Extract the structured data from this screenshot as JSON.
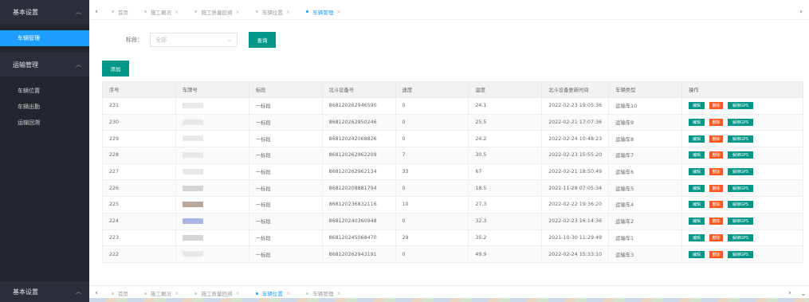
{
  "sidebar": {
    "group1": "基本设置",
    "group1_items": [
      {
        "label": "车辆管理",
        "active": true
      }
    ],
    "group2": "运输管理",
    "group2_items": [
      {
        "label": "车辆位置"
      },
      {
        "label": "车辆出勤"
      },
      {
        "label": "运输回溯"
      }
    ],
    "bottom_group": "基本设置"
  },
  "top_tabs": [
    {
      "label": "首页",
      "active": false
    },
    {
      "label": "施工概况",
      "active": false
    },
    {
      "label": "施工质量回溯",
      "active": false
    },
    {
      "label": "车辆位置",
      "active": false
    },
    {
      "label": "车辆管理",
      "active": true
    }
  ],
  "bottom_tabs": [
    {
      "label": "首页",
      "active": false
    },
    {
      "label": "施工概况",
      "active": false
    },
    {
      "label": "施工质量回溯",
      "active": false
    },
    {
      "label": "车辆位置",
      "active": true
    },
    {
      "label": "车辆管理",
      "active": false
    }
  ],
  "filter": {
    "label": "标段：",
    "placeholder": "全部",
    "query_button": "查询"
  },
  "add_button": "添加",
  "table": {
    "headers": [
      "序号",
      "车牌号",
      "标段",
      "北斗设备号",
      "速度",
      "温度",
      "北斗设备更新时间",
      "车辆类型",
      "操作"
    ],
    "rows": [
      {
        "id": "231",
        "plate": "",
        "section": "一标段",
        "device": "868120262946590",
        "speed": "0",
        "temp": "24.1",
        "time": "2022-02-23 19:05:36",
        "type": "运输车10"
      },
      {
        "id": "230",
        "plate": "",
        "section": "一标段",
        "device": "868120262950246",
        "speed": "0",
        "temp": "25.5",
        "time": "2022-02-21 17:07:36",
        "type": "运输车9"
      },
      {
        "id": "229",
        "plate": "",
        "section": "一标段",
        "device": "868120242068826",
        "speed": "0",
        "temp": "24.2",
        "time": "2022-02-24 10:48:23",
        "type": "运输车8"
      },
      {
        "id": "228",
        "plate": "",
        "section": "一标段",
        "device": "868120262962209",
        "speed": "7",
        "temp": "30.5",
        "time": "2022-02-23 15:55:20",
        "type": "运输车7"
      },
      {
        "id": "227",
        "plate": "",
        "section": "一标段",
        "device": "868120262962134",
        "speed": "33",
        "temp": "67",
        "time": "2022-02-21 18:50:49",
        "type": "运输车6"
      },
      {
        "id": "226",
        "plate": "",
        "section": "一标段",
        "device": "868120208881794",
        "speed": "0",
        "temp": "18.5",
        "time": "2021-11-28 07:05:34",
        "type": "运输车5"
      },
      {
        "id": "225",
        "plate": "",
        "section": "一标段",
        "device": "868120236832116",
        "speed": "10",
        "temp": "27.3",
        "time": "2022-02-22 19:36:20",
        "type": "运输车4"
      },
      {
        "id": "224",
        "plate": "",
        "section": "一标段",
        "device": "868120240360948",
        "speed": "0",
        "temp": "32.3",
        "time": "2022-02-23 16:14:36",
        "type": "运输车2"
      },
      {
        "id": "223",
        "plate": "",
        "section": "一标段",
        "device": "868120245068470",
        "speed": "29",
        "temp": "35.2",
        "time": "2021-10-30 11:29:49",
        "type": "运输车1"
      },
      {
        "id": "222",
        "plate": "",
        "section": "一标段",
        "device": "868120262943191",
        "speed": "0",
        "temp": "49.9",
        "time": "2022-02-24 15:33:10",
        "type": "运输车3"
      }
    ],
    "actions": {
      "edit": "编辑",
      "delete": "删除",
      "gps": "解绑GPS"
    }
  },
  "colors": {
    "primary": "#009688",
    "danger": "#ff5722",
    "active": "#1e9fff",
    "sidebar": "#23262e"
  }
}
